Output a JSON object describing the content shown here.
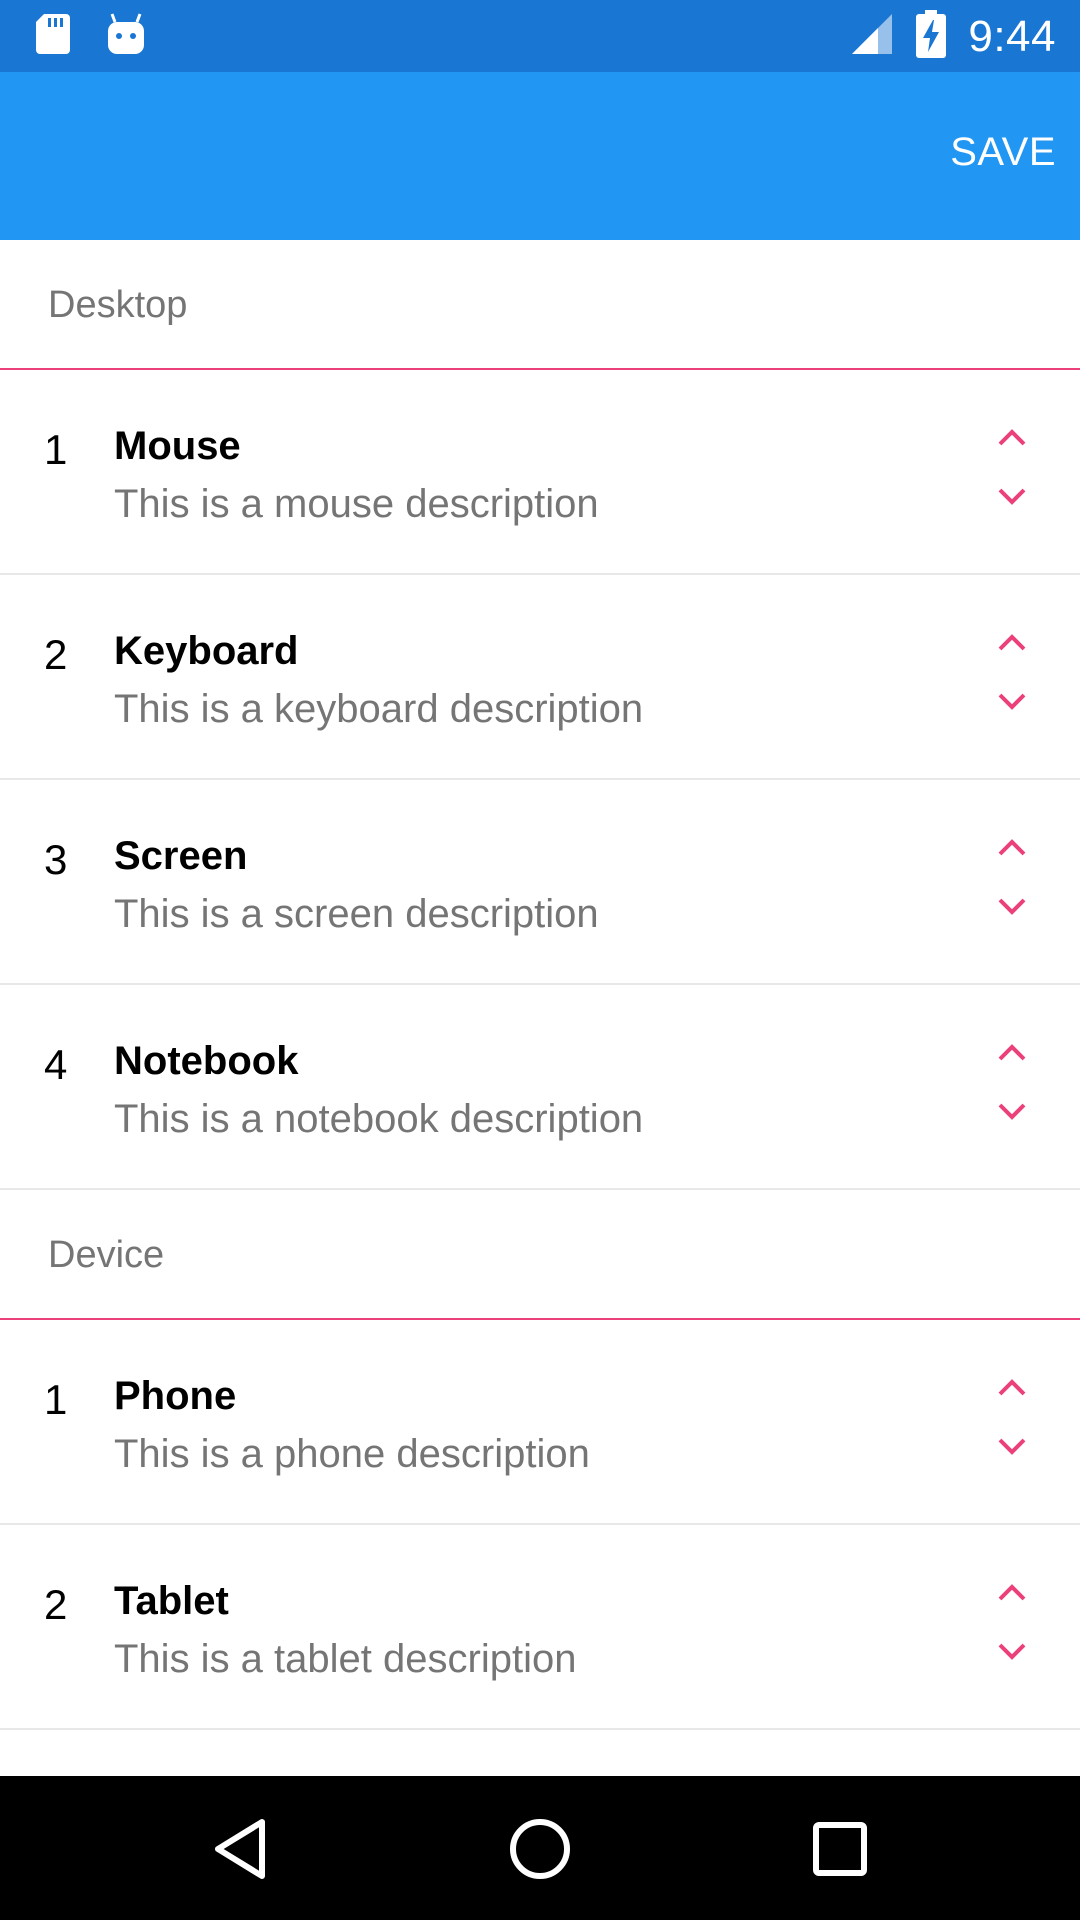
{
  "status_bar": {
    "time": "9:44",
    "icons_left": [
      "sd-card-icon",
      "android-icon"
    ],
    "icons_right": [
      "signal-icon",
      "battery-charging-icon"
    ]
  },
  "app_bar": {
    "save_label": "SAVE",
    "background": "#2196F3",
    "status_background": "#1976D2"
  },
  "sections": [
    {
      "title": "Desktop",
      "items": [
        {
          "num": "1",
          "title": "Mouse",
          "desc": "This is a mouse description"
        },
        {
          "num": "2",
          "title": "Keyboard",
          "desc": "This is a keyboard description"
        },
        {
          "num": "3",
          "title": "Screen",
          "desc": "This is a screen description"
        },
        {
          "num": "4",
          "title": "Notebook",
          "desc": "This is a notebook description"
        }
      ]
    },
    {
      "title": "Device",
      "items": [
        {
          "num": "1",
          "title": "Phone",
          "desc": "This is a phone description"
        },
        {
          "num": "2",
          "title": "Tablet",
          "desc": "This is a tablet description"
        }
      ]
    }
  ],
  "colors": {
    "accent": "#EC407A",
    "divider": "#E8E8E8",
    "secondary_text": "#757575"
  },
  "nav_bar": {
    "icons": [
      "back-icon",
      "home-icon",
      "recents-icon"
    ]
  }
}
